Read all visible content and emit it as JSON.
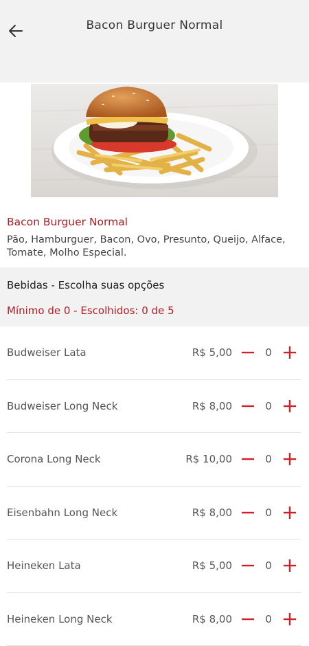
{
  "header": {
    "title": "Bacon Burguer Normal"
  },
  "product": {
    "name": "Bacon Burguer Normal",
    "description": "Pão, Hamburguer, Bacon, Ovo, Presunto, Queijo, Alface, Tomate, Molho Especial."
  },
  "section": {
    "title": "Bebidas - Escolha suas opções",
    "rule": "Mínimo de 0 - Escolhidos: 0 de 5"
  },
  "options": [
    {
      "name": "Budweiser Lata",
      "price": "R$ 5,00",
      "qty": "0"
    },
    {
      "name": "Budweiser Long Neck",
      "price": "R$ 8,00",
      "qty": "0"
    },
    {
      "name": "Corona Long Neck",
      "price": "R$ 10,00",
      "qty": "0"
    },
    {
      "name": "Eisenbahn Long Neck",
      "price": "R$ 8,00",
      "qty": "0"
    },
    {
      "name": "Heineken Lata",
      "price": "R$ 5,00",
      "qty": "0"
    },
    {
      "name": "Heineken Long Neck",
      "price": "R$ 8,00",
      "qty": "0"
    }
  ],
  "colors": {
    "accent": "#b01e25",
    "header_bg": "#f2f2f2",
    "divider": "#e1e1e1"
  },
  "icons": {
    "back": "arrow-left-icon",
    "minus": "minus-icon",
    "plus": "plus-icon"
  }
}
